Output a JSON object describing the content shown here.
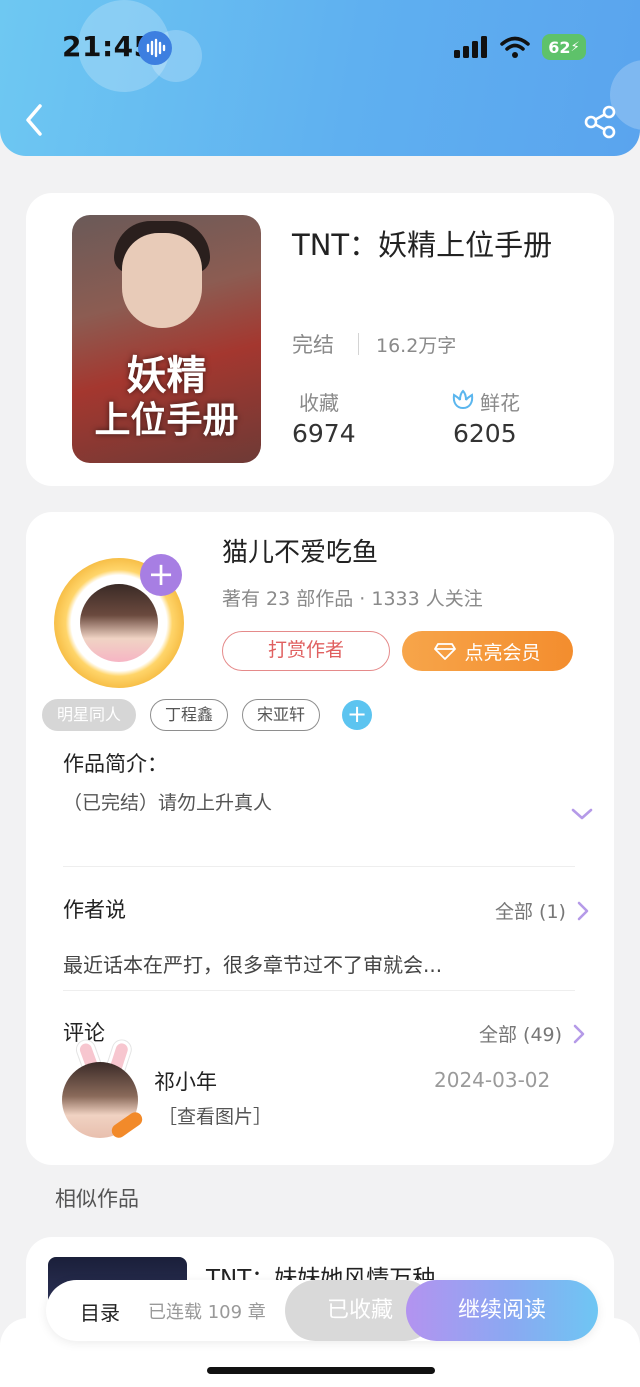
{
  "status_bar": {
    "time": "21:45",
    "battery": "62"
  },
  "colors": {
    "header_start": "#6ec8f2",
    "header_end": "#5aa4ee",
    "vip_orange": "#f38d2e",
    "read_gradient_start": "#b393f0",
    "read_gradient_end": "#6ec6f3",
    "accent_purple": "#a77ee3"
  },
  "header": {
    "back_icon": "chevron-left-icon",
    "share_icon": "share-icon"
  },
  "book": {
    "cover_title_line1": "妖精",
    "cover_title_line2": "上位手册",
    "title": "TNT：妖精上位手册",
    "status": "完结",
    "word_count": "16.2万字",
    "stats": [
      {
        "label": "收藏",
        "value": "6974"
      },
      {
        "label": "鲜花",
        "value": "6205",
        "icon": "flower-icon"
      }
    ]
  },
  "author": {
    "name": "猫儿不爱吃鱼",
    "meta": "著有 23 部作品 · 1333 人关注",
    "reward_label": "打赏作者",
    "vip_label": "点亮会员",
    "vip_icon": "diamond-icon"
  },
  "tags": [
    "明星同人",
    "丁程鑫",
    "宋亚轩"
  ],
  "intro": {
    "title": "作品简介：",
    "text": "（已完结）请勿上升真人"
  },
  "author_say": {
    "title": "作者说",
    "all_label": "全部 (1)",
    "text": "最近话本在严打，很多章节过不了审就会..."
  },
  "comments": {
    "title": "评论",
    "all_label": "全部 (49)",
    "items": [
      {
        "name": "祁小年",
        "date": "2024-03-02",
        "text": "［查看图片］"
      }
    ]
  },
  "similar": {
    "title": "相似作品",
    "items": [
      {
        "title": "TNT：妹妹她风情万种"
      }
    ]
  },
  "action_bar": {
    "toc_label": "目录",
    "chapters": "已连载 109 章",
    "fav_label": "已收藏",
    "read_label": "继续阅读"
  }
}
